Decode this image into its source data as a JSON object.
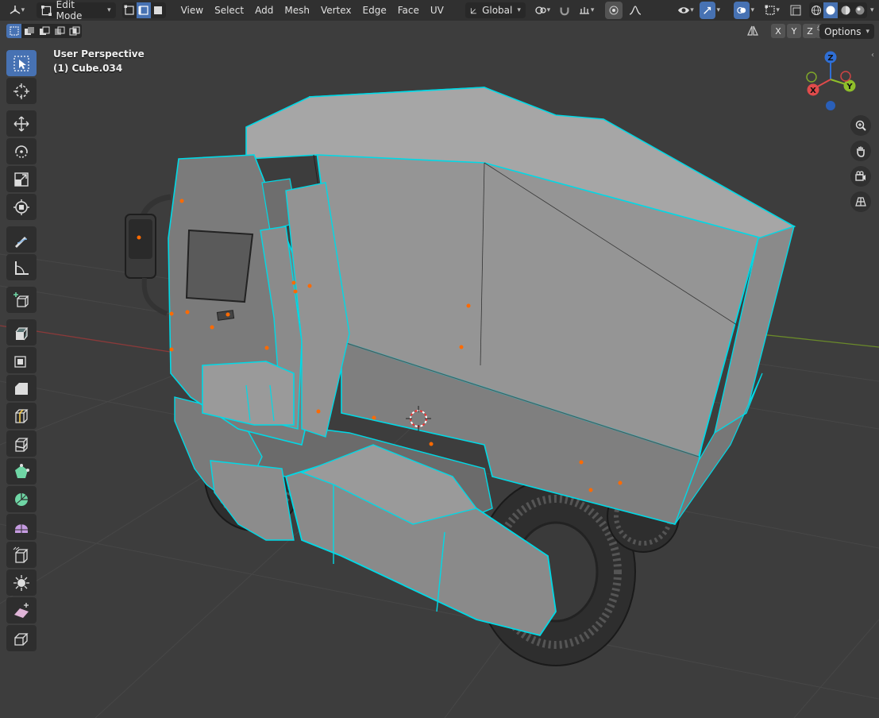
{
  "header": {
    "editor_type_icon": "3d-viewport-icon",
    "mode": "Edit Mode",
    "menus": [
      "View",
      "Select",
      "Add",
      "Mesh",
      "Vertex",
      "Edge",
      "Face",
      "UV"
    ],
    "transform_orientation": "Global"
  },
  "subbar": {
    "axes": [
      "X",
      "Y",
      "Z"
    ],
    "options_label": "Options"
  },
  "viewport": {
    "perspective_label": "User Perspective",
    "object_label": "(1) Cube.034"
  },
  "gizmo": {
    "x": "X",
    "y": "Y",
    "z": "Z"
  },
  "colors": {
    "accent": "#4772b3",
    "edge_highlight": "#00d9e6",
    "vertex": "#ff6a00",
    "background": "#3d3d3d",
    "header": "#303030"
  },
  "toolbar_tools": [
    "select-box-icon",
    "cursor-icon",
    "move-icon",
    "rotate-icon",
    "scale-icon",
    "transform-icon",
    "annotate-icon",
    "measure-icon",
    "add-cube-icon",
    "extrude-region-icon",
    "inset-faces-icon",
    "bevel-icon",
    "loop-cut-icon",
    "knife-icon",
    "poly-build-icon",
    "spin-icon",
    "smooth-icon",
    "edge-slide-icon",
    "shrink-fatten-icon",
    "shear-icon",
    "rip-region-icon"
  ]
}
